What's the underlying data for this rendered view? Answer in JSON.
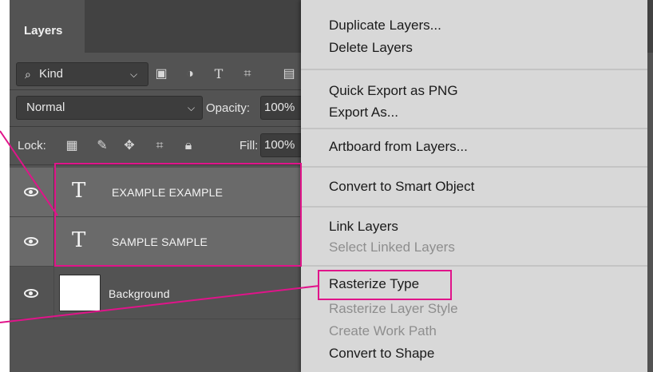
{
  "panel": {
    "tab_label": "Layers",
    "filter": {
      "kind_label": "Kind"
    },
    "blend_mode": "Normal",
    "opacity_label": "Opacity:",
    "opacity_value": "100%",
    "lock_label": "Lock:",
    "fill_label": "Fill:",
    "fill_value": "100%",
    "layers": [
      {
        "name": "EXAMPLE EXAMPLE",
        "type": "text"
      },
      {
        "name": "SAMPLE SAMPLE",
        "type": "text"
      },
      {
        "name": "Background",
        "type": "image"
      }
    ]
  },
  "menu": {
    "items": [
      {
        "label": "Duplicate Layers...",
        "enabled": true
      },
      {
        "label": "Delete Layers",
        "enabled": true
      },
      {
        "label": "Quick Export as PNG",
        "enabled": true
      },
      {
        "label": "Export As...",
        "enabled": true
      },
      {
        "label": "Artboard from Layers...",
        "enabled": true
      },
      {
        "label": "Convert to Smart Object",
        "enabled": true
      },
      {
        "label": "Link Layers",
        "enabled": true
      },
      {
        "label": "Select Linked Layers",
        "enabled": false
      },
      {
        "label": "Rasterize Type",
        "enabled": true
      },
      {
        "label": "Rasterize Layer Style",
        "enabled": false
      },
      {
        "label": "Create Work Path",
        "enabled": false
      },
      {
        "label": "Convert to Shape",
        "enabled": true
      }
    ]
  },
  "colors": {
    "highlight": "#e0148a",
    "panel_bg": "#535353",
    "menu_bg": "#d8d8d8"
  }
}
